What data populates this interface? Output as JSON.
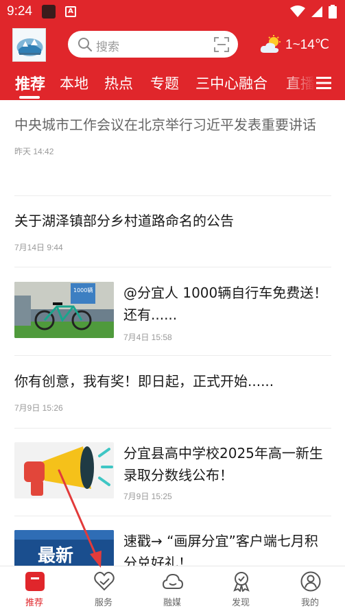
{
  "status_bar": {
    "time": "9:24"
  },
  "header": {
    "search_placeholder": "搜索",
    "weather_text": "1~14℃"
  },
  "tabs": [
    {
      "label": "推荐"
    },
    {
      "label": "本地"
    },
    {
      "label": "热点"
    },
    {
      "label": "专题"
    },
    {
      "label": "三中心融合"
    },
    {
      "label": "直播"
    }
  ],
  "feed": {
    "items": [
      {
        "title": "中央城市工作会议在北京举行习近平发表重要讲话",
        "time": "昨天 14:42"
      },
      {
        "title": "关于湖泽镇部分乡村道路命名的公告",
        "time": "7月14日 9:44"
      },
      {
        "title": "@分宜人 1000辆自行车免费送！还有......",
        "time": "7月4日 15:58",
        "thumb_text": "1000辆"
      },
      {
        "title": "你有创意，我有奖！即日起，正式开始......",
        "time": "7月9日 15:26"
      },
      {
        "title": "分宜县高中学校2025年高一新生录取分数线公布！",
        "time": "7月9日 15:25"
      },
      {
        "title": "速戳→ “画屏分宜”客户端七月积分兑好礼！",
        "time": "",
        "thumb_text": "最新"
      }
    ]
  },
  "bottom_nav": [
    {
      "label": "推荐",
      "icon": "home-tab-icon",
      "active": true
    },
    {
      "label": "服务",
      "icon": "service-heart-icon"
    },
    {
      "label": "融媒",
      "icon": "media-cloud-icon"
    },
    {
      "label": "发现",
      "icon": "discover-badge-icon"
    },
    {
      "label": "我的",
      "icon": "profile-icon"
    }
  ],
  "colors": {
    "brand_red": "#e0262b",
    "overlay_arrow": "#e23b3b"
  }
}
